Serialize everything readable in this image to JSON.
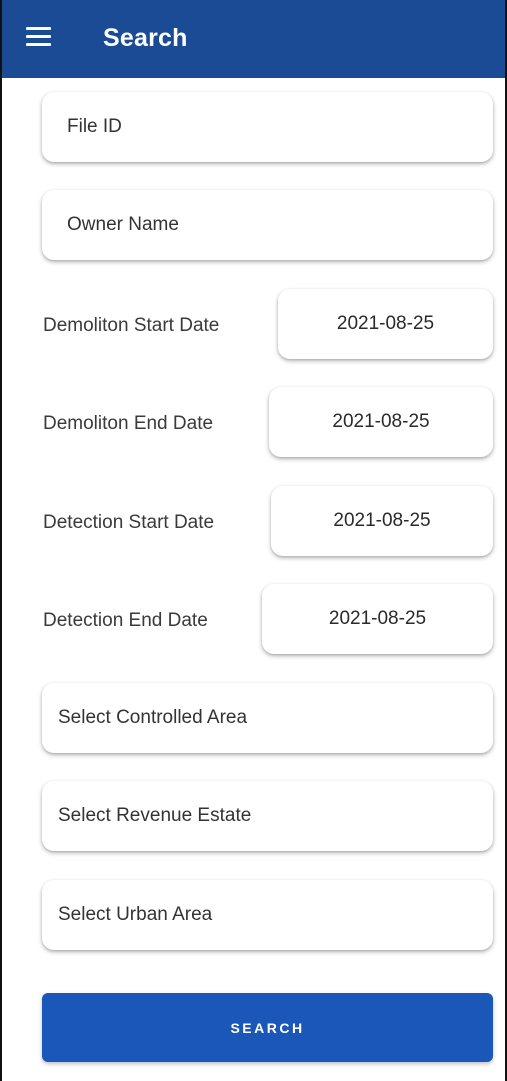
{
  "header": {
    "title": "Search",
    "menu_icon": "hamburger-menu-icon"
  },
  "colors": {
    "app_bar": "#1a4b94",
    "button": "#1a57b8",
    "text": "#333333"
  },
  "form": {
    "file_id_placeholder": "File ID",
    "owner_name_placeholder": "Owner Name",
    "demolition_start": {
      "label": "Demoliton Start Date",
      "value": "2021-08-25"
    },
    "demolition_end": {
      "label": "Demoliton End Date",
      "value": "2021-08-25"
    },
    "detection_start": {
      "label": "Detection Start Date",
      "value": "2021-08-25"
    },
    "detection_end": {
      "label": "Detection End Date",
      "value": "2021-08-25"
    },
    "controlled_area": "Select Controlled Area",
    "revenue_estate": "Select Revenue Estate",
    "urban_area": "Select Urban Area",
    "search_button": "SEARCH"
  }
}
